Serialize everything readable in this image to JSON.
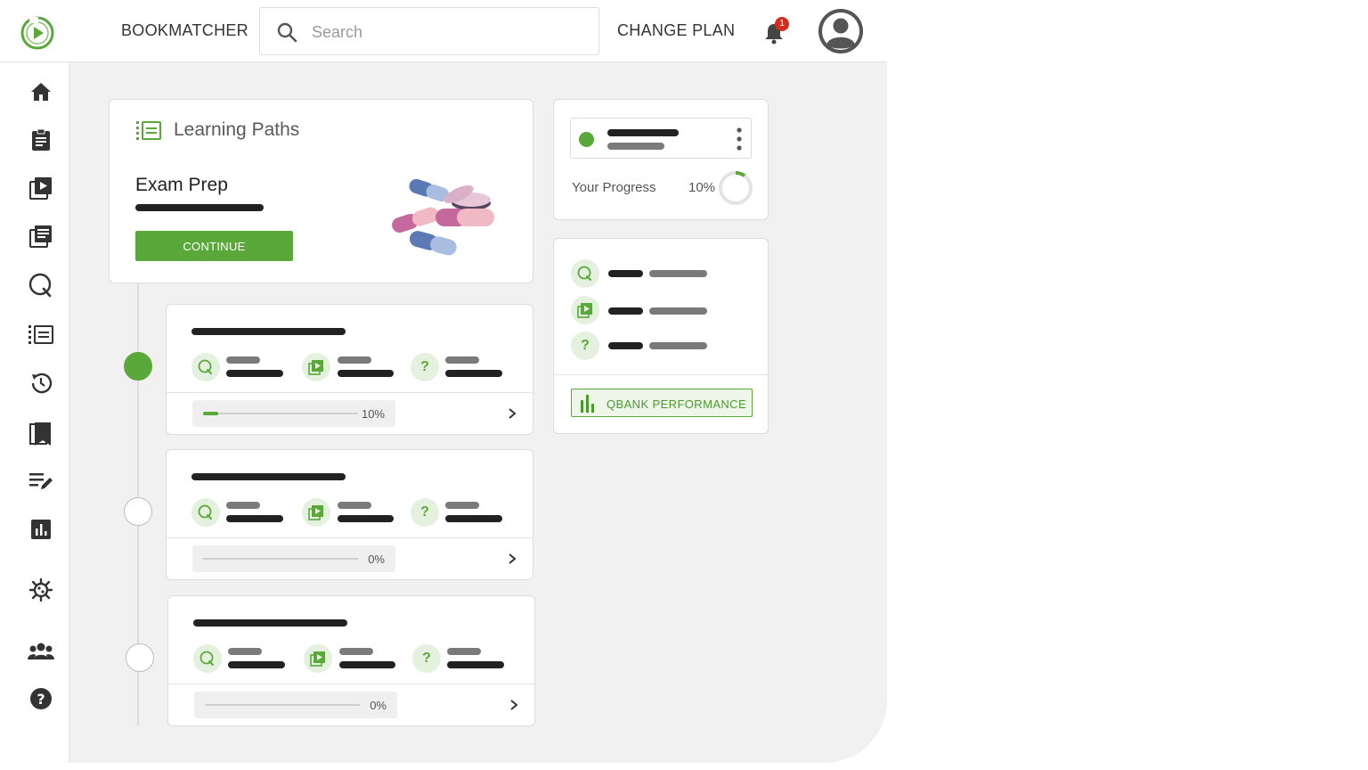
{
  "header": {
    "brand": "BOOKMATCHER",
    "search_placeholder": "Search",
    "change_plan": "CHANGE PLAN",
    "notification_count": "1"
  },
  "sidebar": {
    "items": [
      "home-icon",
      "clipboard-icon",
      "video-library-icon",
      "notes-icon",
      "qbank-icon",
      "learning-paths-icon",
      "history-icon",
      "bookmark-icon",
      "edit-notes-icon",
      "analytics-icon",
      "virus-icon",
      "group-icon",
      "help-icon"
    ]
  },
  "learning_paths": {
    "title": "Learning Paths",
    "path_name": "Exam Prep",
    "continue_label": "CONTINUE",
    "modules": [
      {
        "progress_label": "10%",
        "progress": 0.1,
        "status": "in-progress"
      },
      {
        "progress_label": "0%",
        "progress": 0.0,
        "status": "not-started"
      },
      {
        "progress_label": "0%",
        "progress": 0.0,
        "status": "not-started"
      }
    ]
  },
  "progress_card": {
    "label": "Your Progress",
    "percent_label": "10%",
    "percent": 0.1
  },
  "stats_card": {
    "button_label": "QBANK PERFORMANCE"
  },
  "colors": {
    "accent": "#5aa83a",
    "badge": "#d62b1f",
    "background": "#f1f1f1"
  }
}
